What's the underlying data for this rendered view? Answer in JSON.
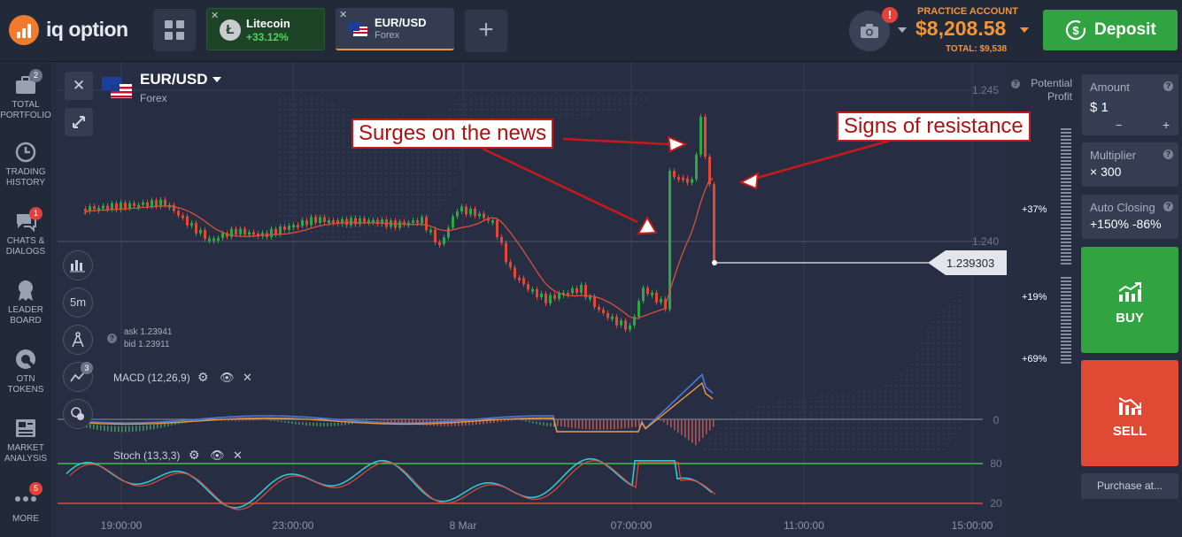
{
  "brand": {
    "name": "iq option"
  },
  "tabs": [
    {
      "name": "Litecoin",
      "change": "+33.12%"
    },
    {
      "name": "EUR/USD",
      "sub": "Forex"
    }
  ],
  "account": {
    "label": "PRACTICE ACCOUNT",
    "balance": "$8,208.58",
    "total": "TOTAL: $9,538",
    "notify_count": "!"
  },
  "deposit_label": "Deposit",
  "sidebar": [
    {
      "label": "TOTAL PORTFOLIO",
      "badge": "2",
      "icon": "briefcase-icon"
    },
    {
      "label": "TRADING HISTORY",
      "icon": "clock-icon"
    },
    {
      "label": "CHATS & DIALOGS",
      "badge": "1",
      "icon": "chat-icon"
    },
    {
      "label": "LEADER BOARD",
      "icon": "medal-icon"
    },
    {
      "label": "OTN TOKENS",
      "icon": "token-icon"
    },
    {
      "label": "MARKET ANALYSIS",
      "icon": "newspaper-icon"
    },
    {
      "label": "MORE",
      "badge": "5",
      "icon": "more-icon"
    }
  ],
  "asset": {
    "name": "EUR/USD",
    "type": "Forex"
  },
  "timeframe": "5m",
  "indicator_count": "3",
  "quote": {
    "ask": "ask 1.23941",
    "bid": "bid 1.23911"
  },
  "current_price": "1.239303",
  "price_levels": [
    "1.245",
    "1.240"
  ],
  "potential_profit": {
    "label": "Potential Profit",
    "levels": [
      "%",
      "+37%",
      "+19%",
      "+69%"
    ]
  },
  "indicators": {
    "macd": "MACD (12,26,9)",
    "macd_zero": "0",
    "stoch": "Stoch (13,3,3)",
    "stoch_levels": [
      "80",
      "20"
    ]
  },
  "time_axis": [
    "19:00:00",
    "23:00:00",
    "8 Mar",
    "07:00:00",
    "11:00:00",
    "15:00:00"
  ],
  "annotations": {
    "surge": "Surges on the news",
    "resistance": "Signs of resistance"
  },
  "trade_panel": {
    "amount": {
      "label": "Amount",
      "value": "$ 1",
      "minus": "−",
      "plus": "+"
    },
    "multiplier": {
      "label": "Multiplier",
      "value": "× 300"
    },
    "auto_closing": {
      "label": "Auto Closing",
      "value": "+150% -86%"
    },
    "buy": "BUY",
    "sell": "SELL",
    "purchase_at": "Purchase at..."
  },
  "colors": {
    "up": "#2ea843",
    "down": "#e04a35",
    "accent": "#f0953a",
    "ma": "#d6503c"
  }
}
